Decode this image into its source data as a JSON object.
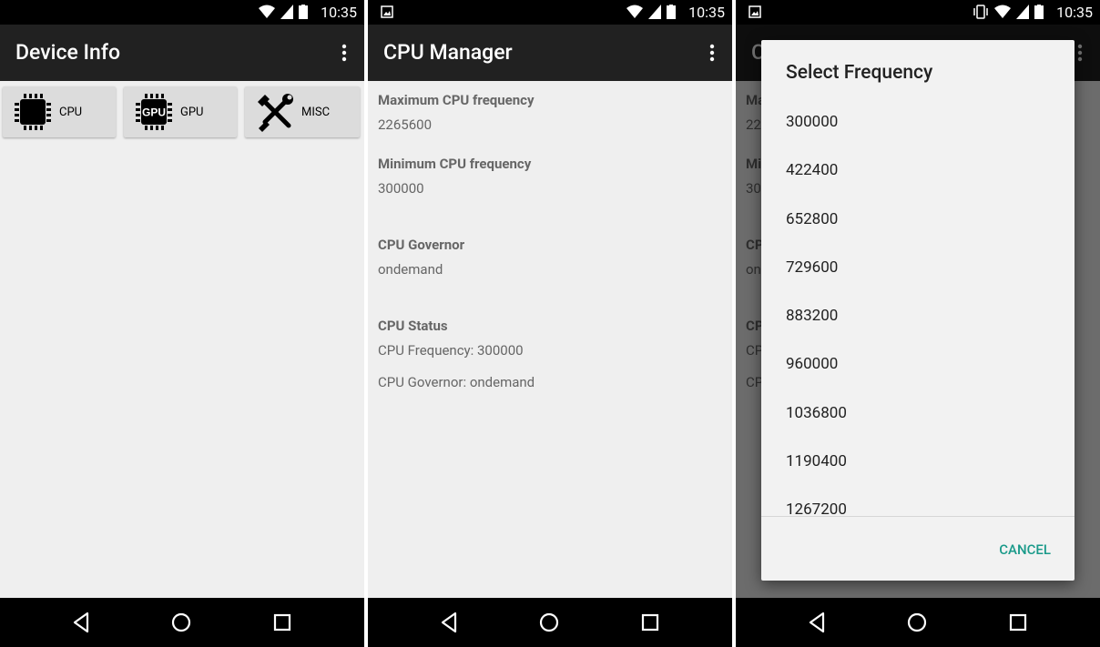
{
  "status": {
    "time": "10:35"
  },
  "screen1": {
    "title": "Device Info",
    "buttons": [
      {
        "label": "CPU",
        "icon": "cpu-chip-icon"
      },
      {
        "label": "GPU",
        "icon": "gpu-chip-icon",
        "chip_text": "GPU"
      },
      {
        "label": "MISC",
        "icon": "tools-icon"
      }
    ]
  },
  "screen2": {
    "title": "CPU Manager",
    "max_label": "Maximum CPU frequency",
    "max_value": "2265600",
    "min_label": "Minimum CPU frequency",
    "min_value": "300000",
    "governor_label": "CPU Governor",
    "governor_value": "ondemand",
    "status_label": "CPU Status",
    "status_freq": "CPU Frequency: 300000",
    "status_governor": "CPU Governor: ondemand"
  },
  "screen3": {
    "dialog_title": "Select Frequency",
    "frequencies": [
      "300000",
      "422400",
      "652800",
      "729600",
      "883200",
      "960000",
      "1036800",
      "1190400",
      "1267200"
    ],
    "cancel_label": "CANCEL"
  },
  "colors": {
    "appbar": "#212121",
    "accent": "#1a9a8a",
    "background": "#efefef"
  }
}
